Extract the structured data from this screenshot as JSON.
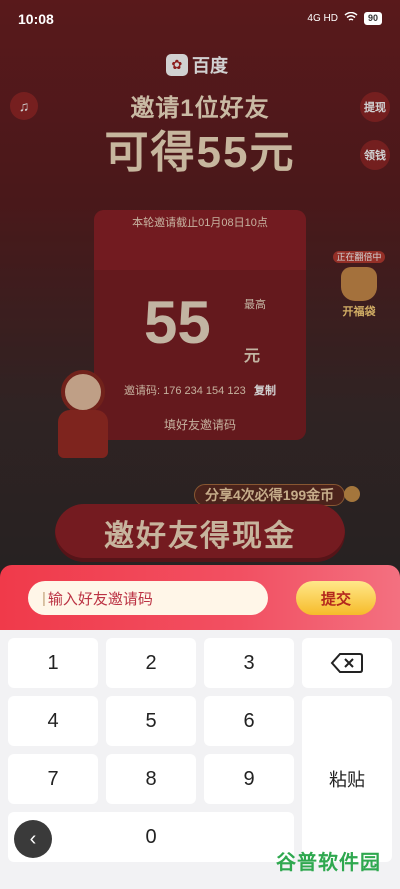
{
  "status_bar": {
    "time": "10:08",
    "network": "4G HD",
    "battery": "90"
  },
  "promo": {
    "logo_text": "百度",
    "headline_line1": "邀请1位好友",
    "headline_line2": "可得55元",
    "side_withdraw": "提现",
    "side_collect": "领钱",
    "envelope": {
      "deadline": "本轮邀请截止01月08日10点",
      "amount": "55",
      "max_label": "最高",
      "unit": "元",
      "invite_code": "邀请码: 176 234 154 123",
      "copy_label": "复制",
      "fill_code_label": "填好友邀请码"
    },
    "lucky": {
      "badge": "正在翻倍中",
      "label": "开福袋"
    },
    "share_text": "分享4次必得199金币",
    "cta_label": "邀好友得现金"
  },
  "invite_input": {
    "placeholder": "输入好友邀请码",
    "submit_label": "提交"
  },
  "keyboard": {
    "keys": [
      "1",
      "2",
      "3",
      "4",
      "5",
      "6",
      "7",
      "8",
      "9",
      "0"
    ],
    "delete_icon": "backspace-icon",
    "paste_label": "粘贴"
  },
  "nav": {
    "back_icon": "chevron-left-icon"
  },
  "watermark": "谷普软件园",
  "colors": {
    "accent": "#f03a4a",
    "submit": "#f6bb2a"
  }
}
